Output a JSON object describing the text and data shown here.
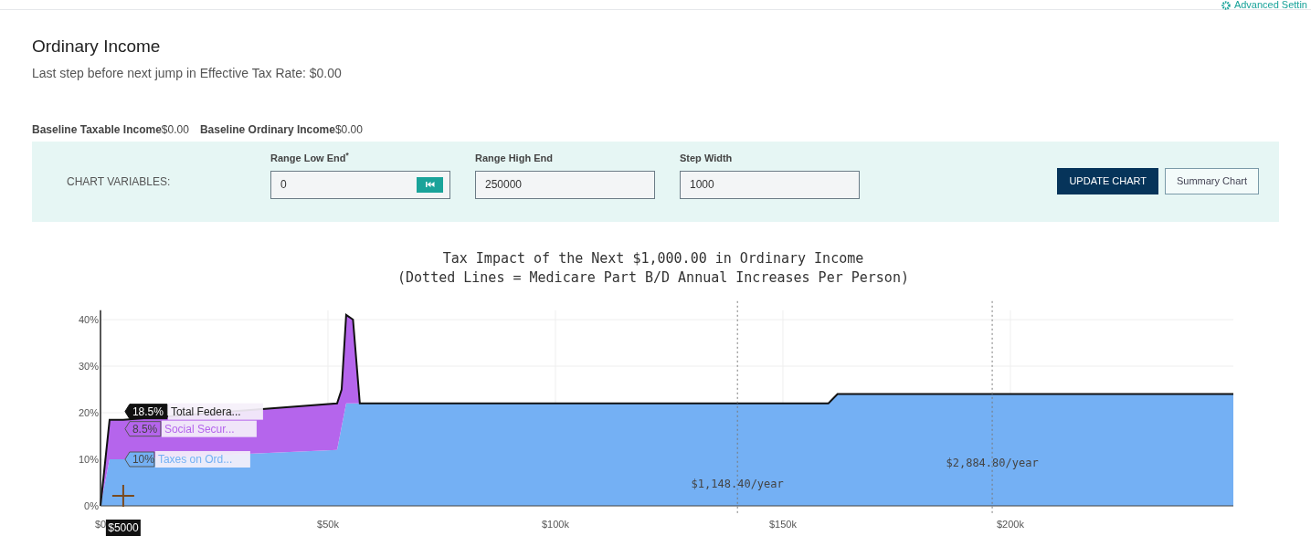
{
  "top_link": {
    "label": "Advanced Settin"
  },
  "section": {
    "title": "Ordinary Income",
    "subtitle": "Last step before next jump in Effective Tax Rate: $0.00"
  },
  "baselines": [
    {
      "label": "Baseline Taxable Income",
      "value": "$0.00"
    },
    {
      "label": "Baseline Ordinary Income",
      "value": "$0.00"
    }
  ],
  "chart_variables": {
    "label": "CHART VARIABLES:",
    "fields": [
      {
        "label": "Range Low End$^{*}$",
        "value": "0",
        "reset_button": true
      },
      {
        "label": "Range High End",
        "value": "250000",
        "reset_button": false
      },
      {
        "label": "Step Width",
        "value": "1000",
        "reset_button": false
      }
    ],
    "buttons": [
      {
        "label": "UPDATE CHART",
        "primary": true
      },
      {
        "label": "Summary Chart",
        "primary": false
      }
    ]
  },
  "chart": {
    "chart_data": {
      "type": "area",
      "title": "Tax Impact of the Next $1,000.00 in Ordinary Income",
      "subtitle": "(Dotted Lines = Medicare Part B/D Annual Increases Per Person)",
      "stacked": true,
      "grid": true,
      "x": [
        0,
        2000,
        5000,
        52000,
        53000,
        54000,
        55500,
        57000,
        160000,
        162000,
        249000
      ],
      "series": [
        {
          "name": "Taxes on Ord...",
          "color": "#74b0f4",
          "values": [
            0,
            10,
            10,
            12,
            17,
            22,
            22,
            22,
            22,
            24,
            24
          ]
        },
        {
          "name": "Social Secur...",
          "color": "#b565ec",
          "values": [
            0,
            8.5,
            8.5,
            10,
            8,
            19,
            18,
            0,
            0,
            0,
            0
          ]
        }
      ],
      "xlim": [
        0,
        249000
      ],
      "ylim": [
        0,
        42
      ],
      "xticks": [
        {
          "value": 0,
          "label": "$0"
        },
        {
          "value": 50000,
          "label": "$50k"
        },
        {
          "value": 100000,
          "label": "$100k"
        },
        {
          "value": 150000,
          "label": "$150k"
        },
        {
          "value": 200000,
          "label": "$200k"
        }
      ],
      "yticks": [
        {
          "value": 0,
          "label": "0%"
        },
        {
          "value": 10,
          "label": "10%"
        },
        {
          "value": 20,
          "label": "20%"
        },
        {
          "value": 30,
          "label": "30%"
        },
        {
          "value": 40,
          "label": "40%"
        }
      ],
      "ref_lines": [
        {
          "axis": "x",
          "value": 140000,
          "label": "$1,148.40/year"
        },
        {
          "axis": "x",
          "value": 196000,
          "label": "$2,884.80/year"
        }
      ]
    },
    "hover": {
      "x_label": "$5000",
      "items": [
        {
          "kind": "total",
          "value": "18.5%",
          "label": "Total Federa..."
        },
        {
          "kind": "series",
          "value": "8.5%"
        },
        {
          "kind": "series",
          "value": "10%"
        }
      ]
    }
  }
}
